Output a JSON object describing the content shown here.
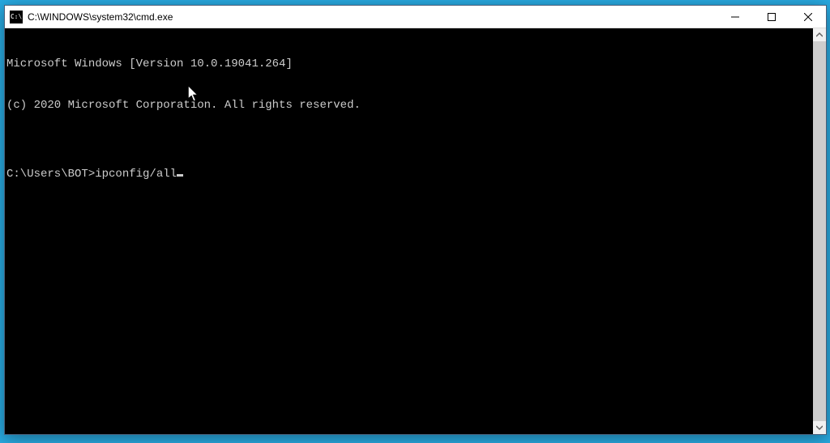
{
  "window": {
    "title": "C:\\WINDOWS\\system32\\cmd.exe",
    "icon_label": "C:\\"
  },
  "terminal": {
    "line1": "Microsoft Windows [Version 10.0.19041.264]",
    "line2": "(c) 2020 Microsoft Corporation. All rights reserved.",
    "blank": "",
    "prompt": "C:\\Users\\BOT>",
    "command": "ipconfig/all"
  },
  "controls": {
    "minimize": "—",
    "maximize": "☐",
    "close": "✕"
  }
}
